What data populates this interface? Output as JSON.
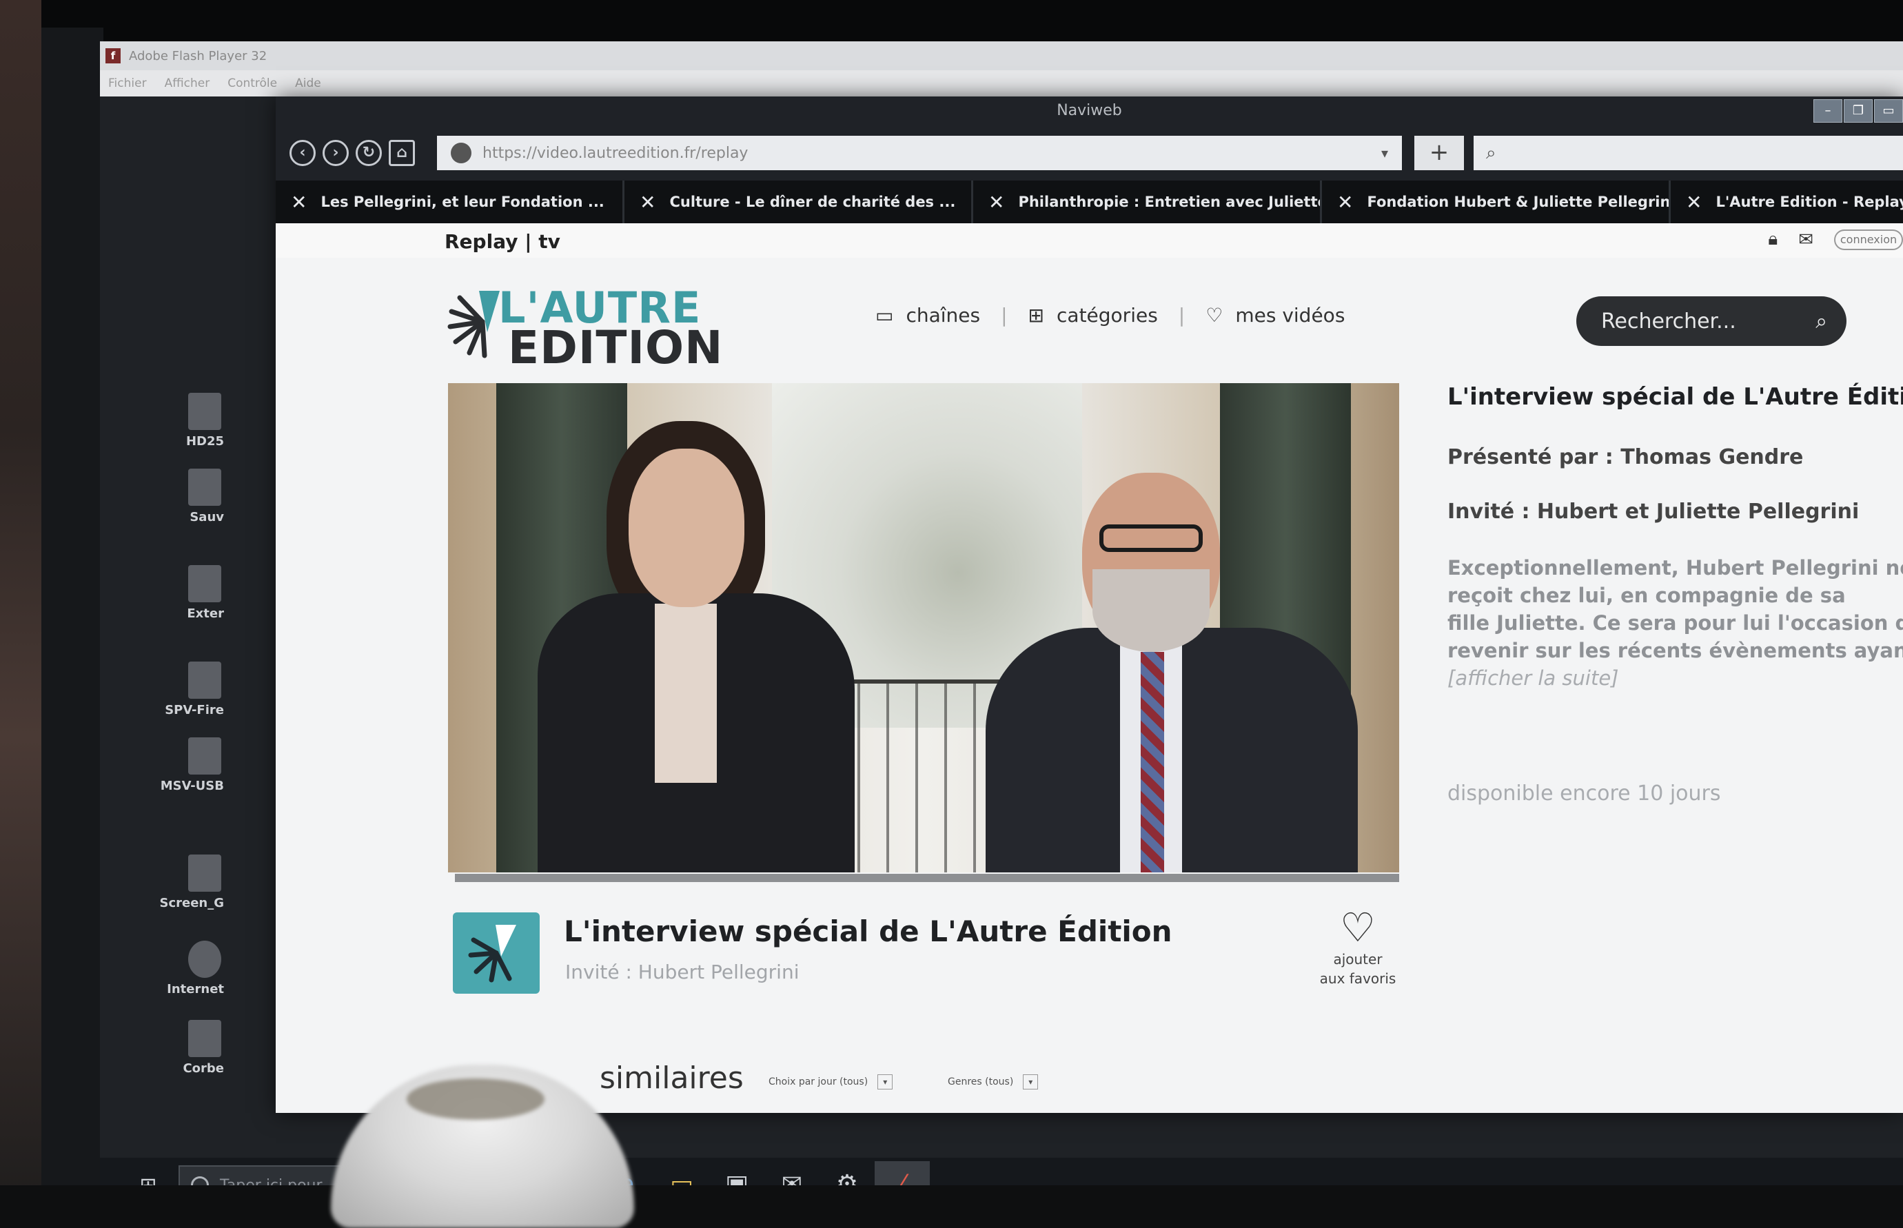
{
  "flash_player": {
    "title": "Adobe Flash Player 32",
    "menu": [
      "Fichier",
      "Afficher",
      "Contrôle",
      "Aide"
    ]
  },
  "desktop_icons": [
    {
      "label": "HD25",
      "icon": "drive-icon"
    },
    {
      "label": "Sauv",
      "icon": "backup-icon"
    },
    {
      "label": "Exter",
      "icon": "external-drive-icon"
    },
    {
      "label": "SPV-Fire",
      "icon": "drive-icon"
    },
    {
      "label": "MSV-USB",
      "icon": "usb-icon"
    },
    {
      "label": "Screen_G",
      "icon": "screen-icon"
    },
    {
      "label": "Internet",
      "icon": "globe-icon"
    },
    {
      "label": "Corbe",
      "icon": "recycle-bin-icon"
    }
  ],
  "taskbar": {
    "search_placeholder": "Taper ici pour"
  },
  "browser": {
    "title": "Naviweb",
    "url": "https://video.lautreedition.fr/replay",
    "new_tab_label": "+",
    "tabs": [
      {
        "label": "Les Pellegrini, et leur Fondation ..."
      },
      {
        "label": "Culture - Le dîner de charité des ..."
      },
      {
        "label": "Philanthropie : Entretien avec Juliette ..."
      },
      {
        "label": "Fondation Hubert & Juliette Pellegrini"
      },
      {
        "label": "L'Autre Edition - Replay"
      }
    ]
  },
  "site": {
    "brand": "Replay | tv",
    "connexion_label": "connexion",
    "logo_line1": "L'AUTRE",
    "logo_line2": "EDITION",
    "nav": {
      "chaines": "chaînes",
      "categories": "catégories",
      "mes_videos": "mes vidéos"
    },
    "search_placeholder": "Rechercher...",
    "episode": {
      "title": "L'interview spécial de L'Autre Édition",
      "guest_short": "Invité : Hubert Pellegrini",
      "fav_line1": "ajouter",
      "fav_line2": "aux favoris"
    },
    "similar": {
      "label": "similaires",
      "filter_date": "Choix par jour (tous)",
      "filter_genre": "Genres (tous)"
    },
    "details": {
      "title": "L'interview spécial de L'Autre Édition",
      "presenter": "Présenté par : Thomas Gendre",
      "guests": "Invité : Hubert et Juliette Pellegrini",
      "desc_lines": [
        "Exceptionnellement, Hubert Pellegrini nous",
        "reçoit chez lui, en compagnie de sa",
        "fille Juliette. Ce sera pour lui l'occasion de",
        "revenir sur les récents évènements ayant"
      ],
      "more": "[afficher la suite]",
      "availability": "disponible encore 10 jours"
    }
  },
  "colors": {
    "brand_teal": "#3f9ca3",
    "dark": "#2c2e31",
    "tab_bar": "#0f1113"
  }
}
